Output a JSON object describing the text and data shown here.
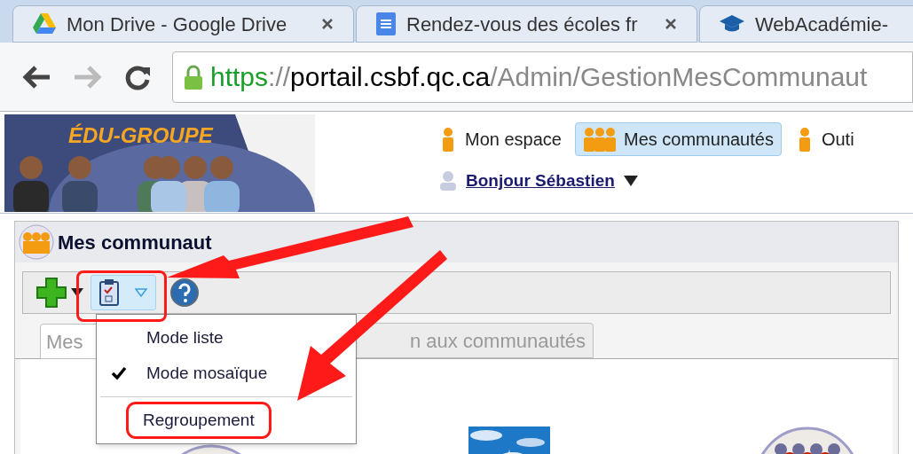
{
  "browser_tabs": [
    {
      "title": "Mon Drive - Google Drive"
    },
    {
      "title": "Rendez-vous des écoles fr"
    },
    {
      "title": "WebAcadémie-"
    }
  ],
  "address": {
    "scheme": "https",
    "separator": "://",
    "host": "portail.csbf.qc.ca",
    "path": "/Admin/GestionMesCommunaut"
  },
  "site": {
    "logo": "ÉDU-GROUPE",
    "nav": [
      {
        "label": "Mon espace",
        "selected": false
      },
      {
        "label": "Mes communautés",
        "selected": true
      },
      {
        "label": "Outi",
        "selected": false
      }
    ],
    "greeting": "Bonjour Sébastien"
  },
  "panel": {
    "title": "Mes communaut",
    "view_button": {
      "pressed": true,
      "annotated": true
    },
    "tabs": [
      {
        "label": "Mes",
        "selected": true
      },
      {
        "label": "n aux communautés",
        "selected": false
      }
    ],
    "menu": [
      {
        "kind": "item",
        "label": "Mode liste",
        "checked": false,
        "annotated": false
      },
      {
        "kind": "item",
        "label": "Mode mosaïque",
        "checked": true,
        "annotated": false
      },
      {
        "kind": "divider"
      },
      {
        "kind": "item",
        "label": "Regroupement",
        "checked": false,
        "annotated": true
      }
    ]
  }
}
